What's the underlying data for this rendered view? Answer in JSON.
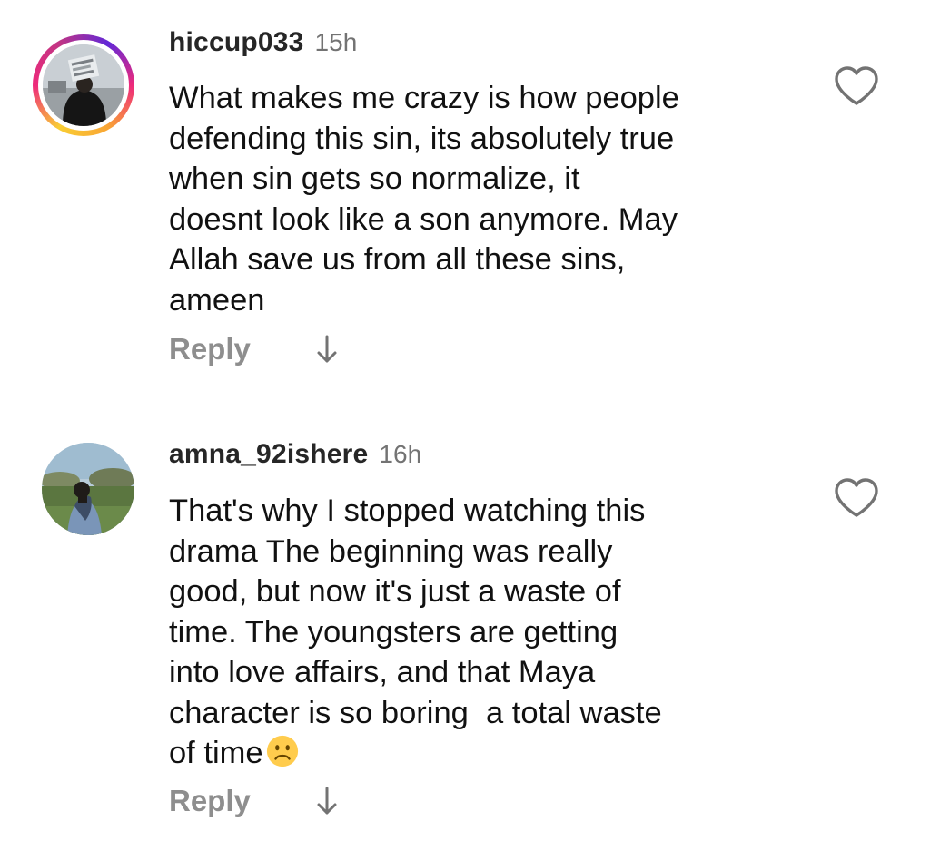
{
  "comments": [
    {
      "username": "hiccup033",
      "time": "15h",
      "text_lines": [
        "What makes me crazy is how people",
        "defending this sin, its absolutely true",
        "when sin gets so normalize, it",
        "doesnt look like a son anymore. May",
        "Allah save us from all these sins,",
        "ameen"
      ],
      "reply_label": "Reply",
      "has_story_ring": true,
      "icons": {
        "like": "heart-outline-icon",
        "expand": "arrow-down-icon"
      }
    },
    {
      "username": "amna_92ishere",
      "time": "16h",
      "text_lines": [
        "That's why I stopped watching this",
        "drama The beginning was really",
        "good, but now it's just a waste of",
        "time. The youngsters are getting",
        "into love affairs, and that Maya",
        "character is so boring  a total waste",
        "of time"
      ],
      "trailing_emoji": "slightly-frowning-face",
      "reply_label": "Reply",
      "has_story_ring": false,
      "icons": {
        "like": "heart-outline-icon",
        "expand": "arrow-down-icon"
      }
    }
  ],
  "colors": {
    "text": "#111111",
    "username": "#262626",
    "muted": "#737373",
    "reply": "#8e8e8e",
    "icon": "#737373",
    "emoji": "#FFCC4D"
  }
}
